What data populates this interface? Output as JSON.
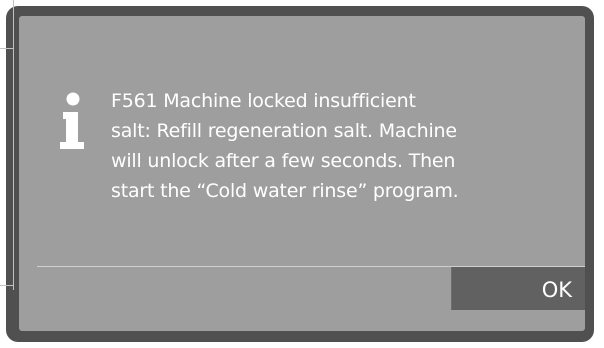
{
  "dialog": {
    "icon": "info-icon",
    "message": "F561 Machine locked insufficient\nsalt: Refill regeneration salt. Machine\nwill unlock after a few seconds. Then\nstart the “Cold water rinse” program.",
    "ok_label": "OK"
  },
  "colors": {
    "frame": "#505050",
    "screen": "#9e9e9e",
    "button": "#616161",
    "text": "#ffffff"
  }
}
